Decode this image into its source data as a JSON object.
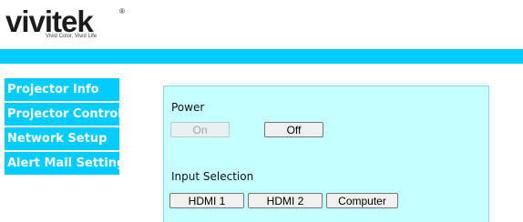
{
  "logo": {
    "wordmark": "vivitek",
    "registered": "®",
    "tagline": "Vivid Color, Vivid Life"
  },
  "sidebar": {
    "items": [
      {
        "label": "Projector Info"
      },
      {
        "label": "Projector Control"
      },
      {
        "label": "Network Setup"
      },
      {
        "label": "Alert Mail Settings"
      }
    ]
  },
  "power": {
    "label": "Power",
    "on_label": "On",
    "off_label": "Off"
  },
  "input": {
    "label": "Input Selection",
    "options": [
      "HDMI 1",
      "HDMI 2",
      "Computer"
    ]
  },
  "colors": {
    "accent": "#00ccff",
    "panel_background": "#c6ffff"
  }
}
